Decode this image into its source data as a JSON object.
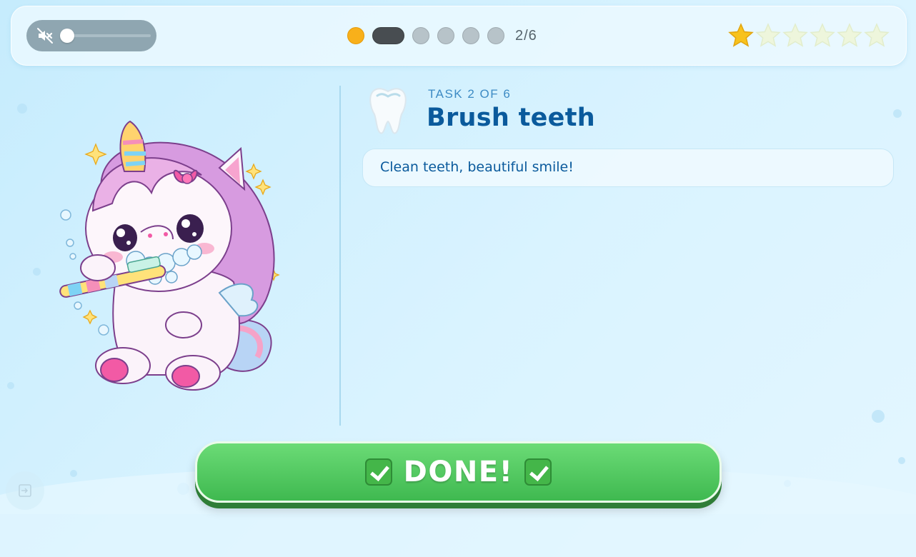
{
  "app": {
    "accent": "#0a5a9c",
    "background": "#c6ecfd"
  },
  "sound": {
    "icon": "mute-speaker-icon",
    "volume": 0
  },
  "progress": {
    "label": "2/6",
    "total": 6,
    "current": 2,
    "completed": 1
  },
  "stars": {
    "earned": 1,
    "total": 6,
    "earned_color": "#f8c21c"
  },
  "illustration": {
    "icon": "unicorn-brushing-teeth-icon"
  },
  "task": {
    "icon": "tooth-icon",
    "kicker": "TASK 2 OF 6",
    "title": "Brush teeth",
    "description": "Clean teeth, beautiful smile!"
  },
  "done_button": {
    "label": "DONE!",
    "icon": "checkmark-box-icon",
    "color": "#3fb950"
  },
  "exit": {
    "icon": "exit-icon"
  }
}
